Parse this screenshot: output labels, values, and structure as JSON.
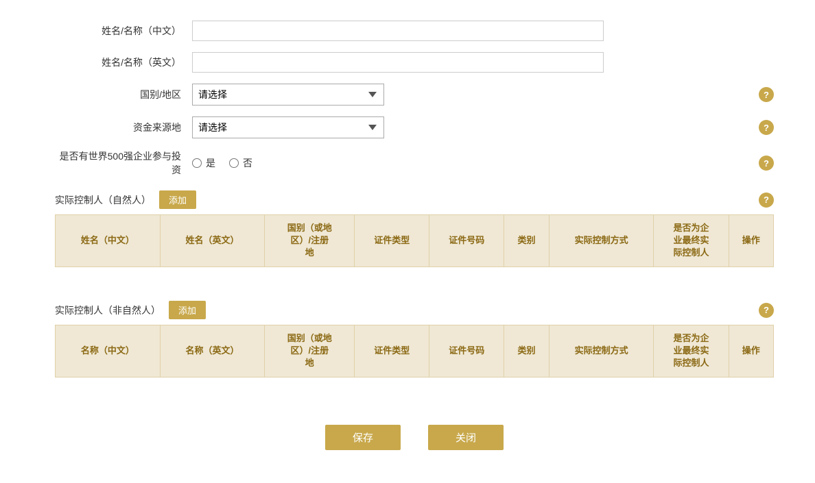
{
  "form": {
    "name_cn_label": "姓名/名称（中文）",
    "name_en_label": "姓名/名称（英文）",
    "country_label": "国别/地区",
    "fund_source_label": "资金来源地",
    "fortune500_label": "是否有世界500强企业参与投资",
    "select_placeholder": "请选择",
    "radio_yes": "是",
    "radio_no": "否",
    "help_icon": "?"
  },
  "natural_person": {
    "title": "实际控制人（自然人）",
    "add_btn": "添加",
    "columns": [
      "姓名（中文）",
      "姓名（英文）",
      "国别（或地区）/注册地",
      "证件类型",
      "证件号码",
      "类别",
      "实际控制方式",
      "是否为企业最终实际控制人",
      "操作"
    ]
  },
  "non_natural_person": {
    "title": "实际控制人（非自然人）",
    "add_btn": "添加",
    "columns": [
      "名称（中文）",
      "名称（英文）",
      "国别（或地区）/注册地",
      "证件类型",
      "证件号码",
      "类别",
      "实际控制方式",
      "是否为企业最终实际控制人",
      "操作"
    ]
  },
  "buttons": {
    "save": "保存",
    "close": "关闭"
  }
}
